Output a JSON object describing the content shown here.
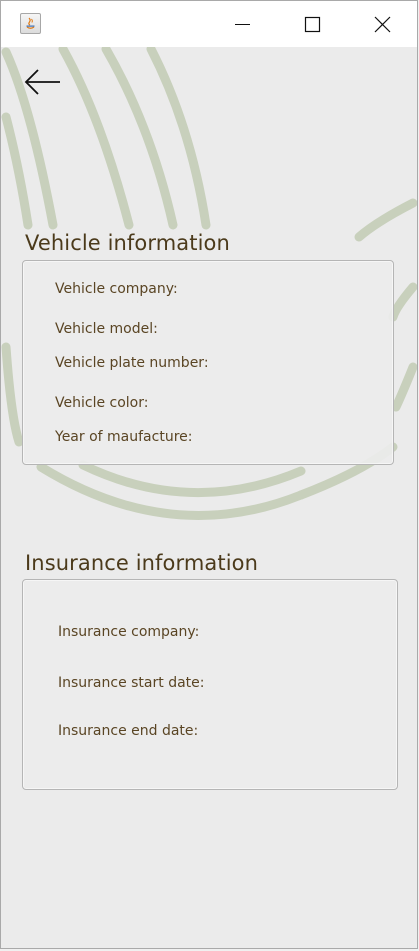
{
  "window": {
    "icon": "java-app-icon",
    "controls": [
      "minimize-icon",
      "maximize-icon",
      "close-icon"
    ]
  },
  "navigation": {
    "back_icon": "arrow-left-icon"
  },
  "vehicle": {
    "title": "Vehicle information",
    "fields": [
      "Vehicle company:",
      "Vehicle model:",
      "Vehicle plate number:",
      "Vehicle color:",
      "Year of maufacture:"
    ]
  },
  "insurance": {
    "title": "Insurance information",
    "fields": [
      "Insurance company:",
      "Insurance start date:",
      "Insurance end date:"
    ]
  },
  "colors": {
    "background": "#ebebeb",
    "decor_lines": "#c8d0bc",
    "text": "#5a4524",
    "title_text": "#4b3a1b"
  }
}
